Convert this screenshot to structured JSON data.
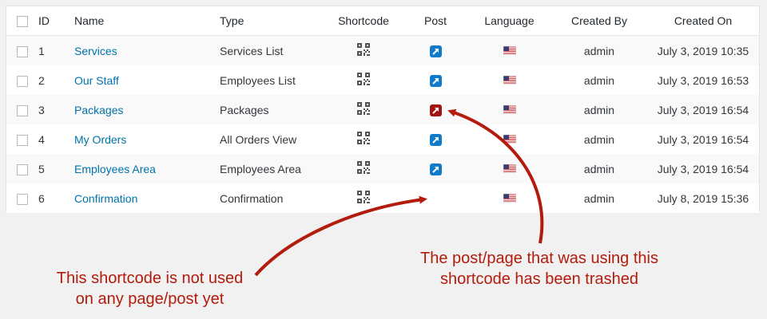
{
  "table": {
    "headers": {
      "id": "ID",
      "name": "Name",
      "type": "Type",
      "shortcode": "Shortcode",
      "post": "Post",
      "language": "Language",
      "created_by": "Created By",
      "created_on": "Created On"
    },
    "rows": [
      {
        "id": "1",
        "name": "Services",
        "type": "Services List",
        "post_status": "linked",
        "created_by": "admin",
        "created_on": "July 3, 2019 10:35"
      },
      {
        "id": "2",
        "name": "Our Staff",
        "type": "Employees List",
        "post_status": "linked",
        "created_by": "admin",
        "created_on": "July 3, 2019 16:53"
      },
      {
        "id": "3",
        "name": "Packages",
        "type": "Packages",
        "post_status": "trashed",
        "created_by": "admin",
        "created_on": "July 3, 2019 16:54"
      },
      {
        "id": "4",
        "name": "My Orders",
        "type": "All Orders View",
        "post_status": "linked",
        "created_by": "admin",
        "created_on": "July 3, 2019 16:54"
      },
      {
        "id": "5",
        "name": "Employees Area",
        "type": "Employees Area",
        "post_status": "linked",
        "created_by": "admin",
        "created_on": "July 3, 2019 16:54"
      },
      {
        "id": "6",
        "name": "Confirmation",
        "type": "Confirmation",
        "post_status": "none",
        "created_by": "admin",
        "created_on": "July 8, 2019 15:36"
      }
    ]
  },
  "annotations": {
    "not_used_line1": "This shortcode is not used",
    "not_used_line2": "on any page/post yet",
    "trashed_line1": "The post/page that was using this",
    "trashed_line2": "shortcode has been trashed"
  },
  "colors": {
    "link": "#0073aa",
    "post_linked": "#0f7ac9",
    "post_trashed": "#a51212",
    "annotation": "#b31b0c"
  },
  "icons": {
    "shortcode": "qr-code-icon",
    "post": "external-link-icon",
    "language": "us-flag-icon"
  }
}
